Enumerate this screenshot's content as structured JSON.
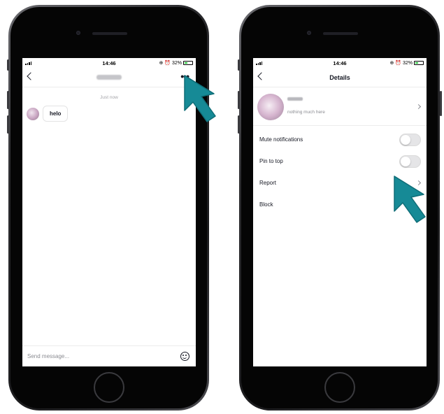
{
  "left_screen": {
    "status": {
      "time": "14:46",
      "battery": "32%"
    },
    "header": {
      "more_icon": "more-dots-icon"
    },
    "chat": {
      "timestamp": "Just now",
      "messages": [
        {
          "text": "helo"
        }
      ]
    },
    "composer": {
      "placeholder": "Send message..."
    }
  },
  "right_screen": {
    "status": {
      "time": "14:46",
      "battery": "32%"
    },
    "header": {
      "title": "Details"
    },
    "profile": {
      "bio": "nothing much here"
    },
    "settings": {
      "mute_label": "Mute notifications",
      "pin_label": "Pin to top",
      "report_label": "Report",
      "block_label": "Block"
    }
  },
  "colors": {
    "accent_arrow": "#168a96",
    "battery_green": "#29c740"
  }
}
